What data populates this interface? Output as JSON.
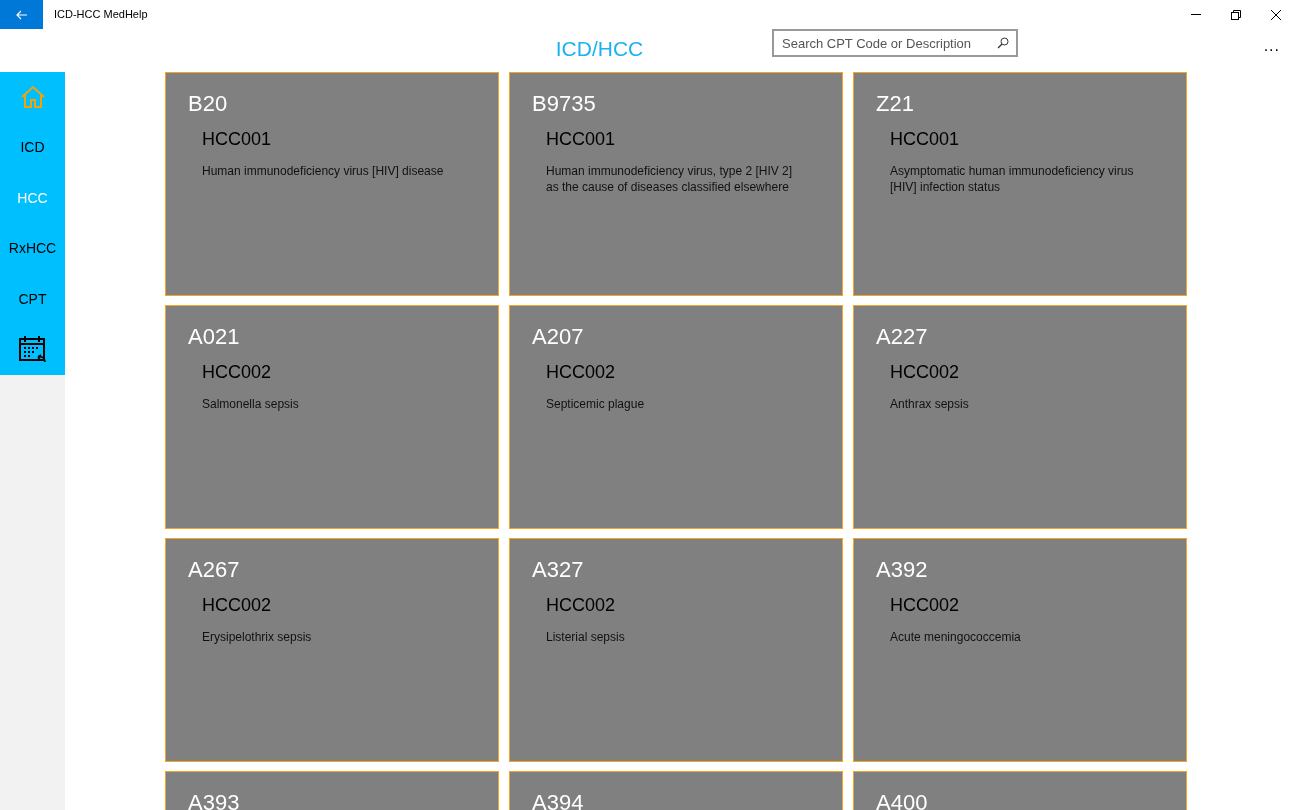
{
  "window": {
    "title": "ICD-HCC MedHelp"
  },
  "header": {
    "title": "ICD/HCC",
    "search": {
      "placeholder": "Search CPT Code or Description"
    },
    "more": "..."
  },
  "sidebar": {
    "items": [
      {
        "kind": "home",
        "selected": false
      },
      {
        "kind": "text",
        "label": "ICD",
        "selected": false
      },
      {
        "kind": "text",
        "label": "HCC",
        "selected": true
      },
      {
        "kind": "text",
        "label": "RxHCC",
        "selected": false
      },
      {
        "kind": "text",
        "label": "CPT",
        "selected": false
      },
      {
        "kind": "calendar",
        "selected": false
      }
    ]
  },
  "cards": [
    {
      "code": "B20",
      "hcc": "HCC001",
      "description": "Human immunodeficiency virus [HIV] disease"
    },
    {
      "code": "B9735",
      "hcc": "HCC001",
      "description": "Human immunodeficiency virus, type 2 [HIV 2] as the cause of diseases classified elsewhere"
    },
    {
      "code": "Z21",
      "hcc": "HCC001",
      "description": "Asymptomatic human immunodeficiency virus [HIV] infection status"
    },
    {
      "code": "A021",
      "hcc": "HCC002",
      "description": "Salmonella sepsis"
    },
    {
      "code": "A207",
      "hcc": "HCC002",
      "description": "Septicemic plague"
    },
    {
      "code": "A227",
      "hcc": "HCC002",
      "description": "Anthrax sepsis"
    },
    {
      "code": "A267",
      "hcc": "HCC002",
      "description": "Erysipelothrix sepsis"
    },
    {
      "code": "A327",
      "hcc": "HCC002",
      "description": "Listerial sepsis"
    },
    {
      "code": "A392",
      "hcc": "HCC002",
      "description": "Acute meningococcemia"
    },
    {
      "code": "A393"
    },
    {
      "code": "A394"
    },
    {
      "code": "A400"
    }
  ]
}
